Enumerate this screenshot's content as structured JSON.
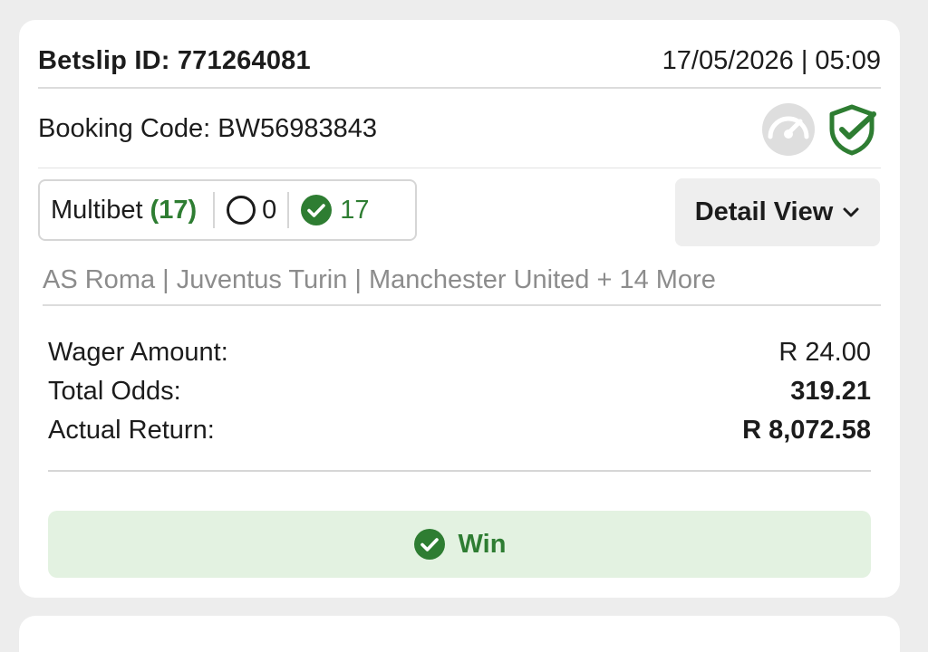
{
  "betslip": {
    "title": "Betslip ID: 771264081",
    "datetime": "17/05/2026 | 05:09",
    "booking_code": "Booking Code: BW56983843",
    "icons": {
      "speed": "speedometer-icon",
      "verified": "shield-check-icon"
    }
  },
  "multibet": {
    "label": "Multibet",
    "count": "(17)",
    "open_count": "0",
    "won_count": "17"
  },
  "detail_button": {
    "label": "Detail View"
  },
  "teams_summary": "AS Roma | Juventus Turin | Manchester United + 14 More",
  "summary": {
    "wager_label": "Wager Amount:",
    "wager_value": "R 24.00",
    "odds_label": "Total Odds:",
    "odds_value": "319.21",
    "return_label": "Actual Return:",
    "return_value": "R 8,072.58"
  },
  "result": {
    "label": "Win"
  },
  "colors": {
    "accent_green": "#2e7d32",
    "win_bg": "#e3f2e1",
    "muted_text": "#8c8c8c",
    "page_bg": "#ededed"
  }
}
